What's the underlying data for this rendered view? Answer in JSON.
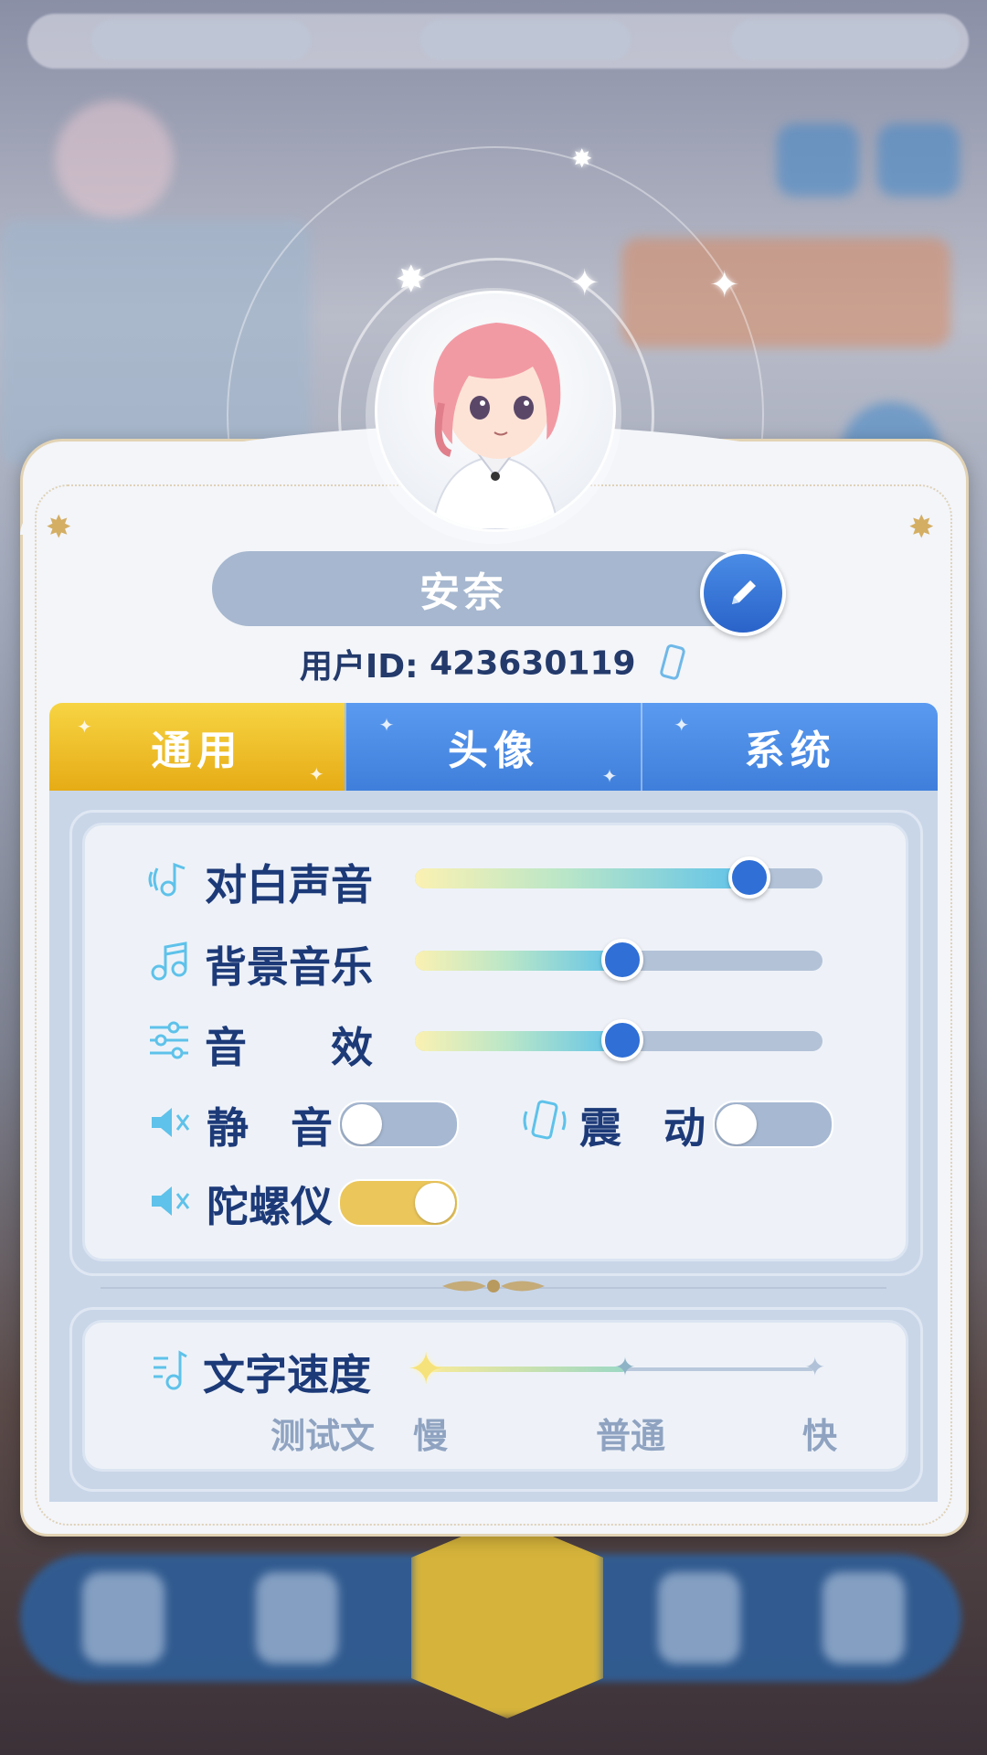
{
  "profile": {
    "name": "安奈",
    "uid_label": "用户ID:",
    "uid_value": "423630119"
  },
  "tabs": [
    {
      "label": "通用",
      "active": true
    },
    {
      "label": "头像",
      "active": false
    },
    {
      "label": "系统",
      "active": false
    }
  ],
  "audio": {
    "dialogue": {
      "label": "对白声音",
      "value": 0.82
    },
    "bgm": {
      "label": "背景音乐",
      "value": 0.51
    },
    "sfx": {
      "label": "音　　效",
      "value": 0.51
    }
  },
  "toggles": {
    "mute": {
      "label": "静　音",
      "on": false
    },
    "vibrate": {
      "label": "震　动",
      "on": false
    },
    "gyro": {
      "label": "陀螺仪",
      "on": true
    }
  },
  "text_speed": {
    "label": "文字速度",
    "preview": "测试文",
    "slow": "慢",
    "normal": "普通",
    "fast": "快",
    "value": 0.51
  },
  "colors": {
    "tab_active": "#e6ac16",
    "tab_inactive": "#3f7fdb",
    "label_text": "#1d3a78",
    "accent_blue": "#2f6fd6",
    "toggle_on": "#ebc65b"
  }
}
